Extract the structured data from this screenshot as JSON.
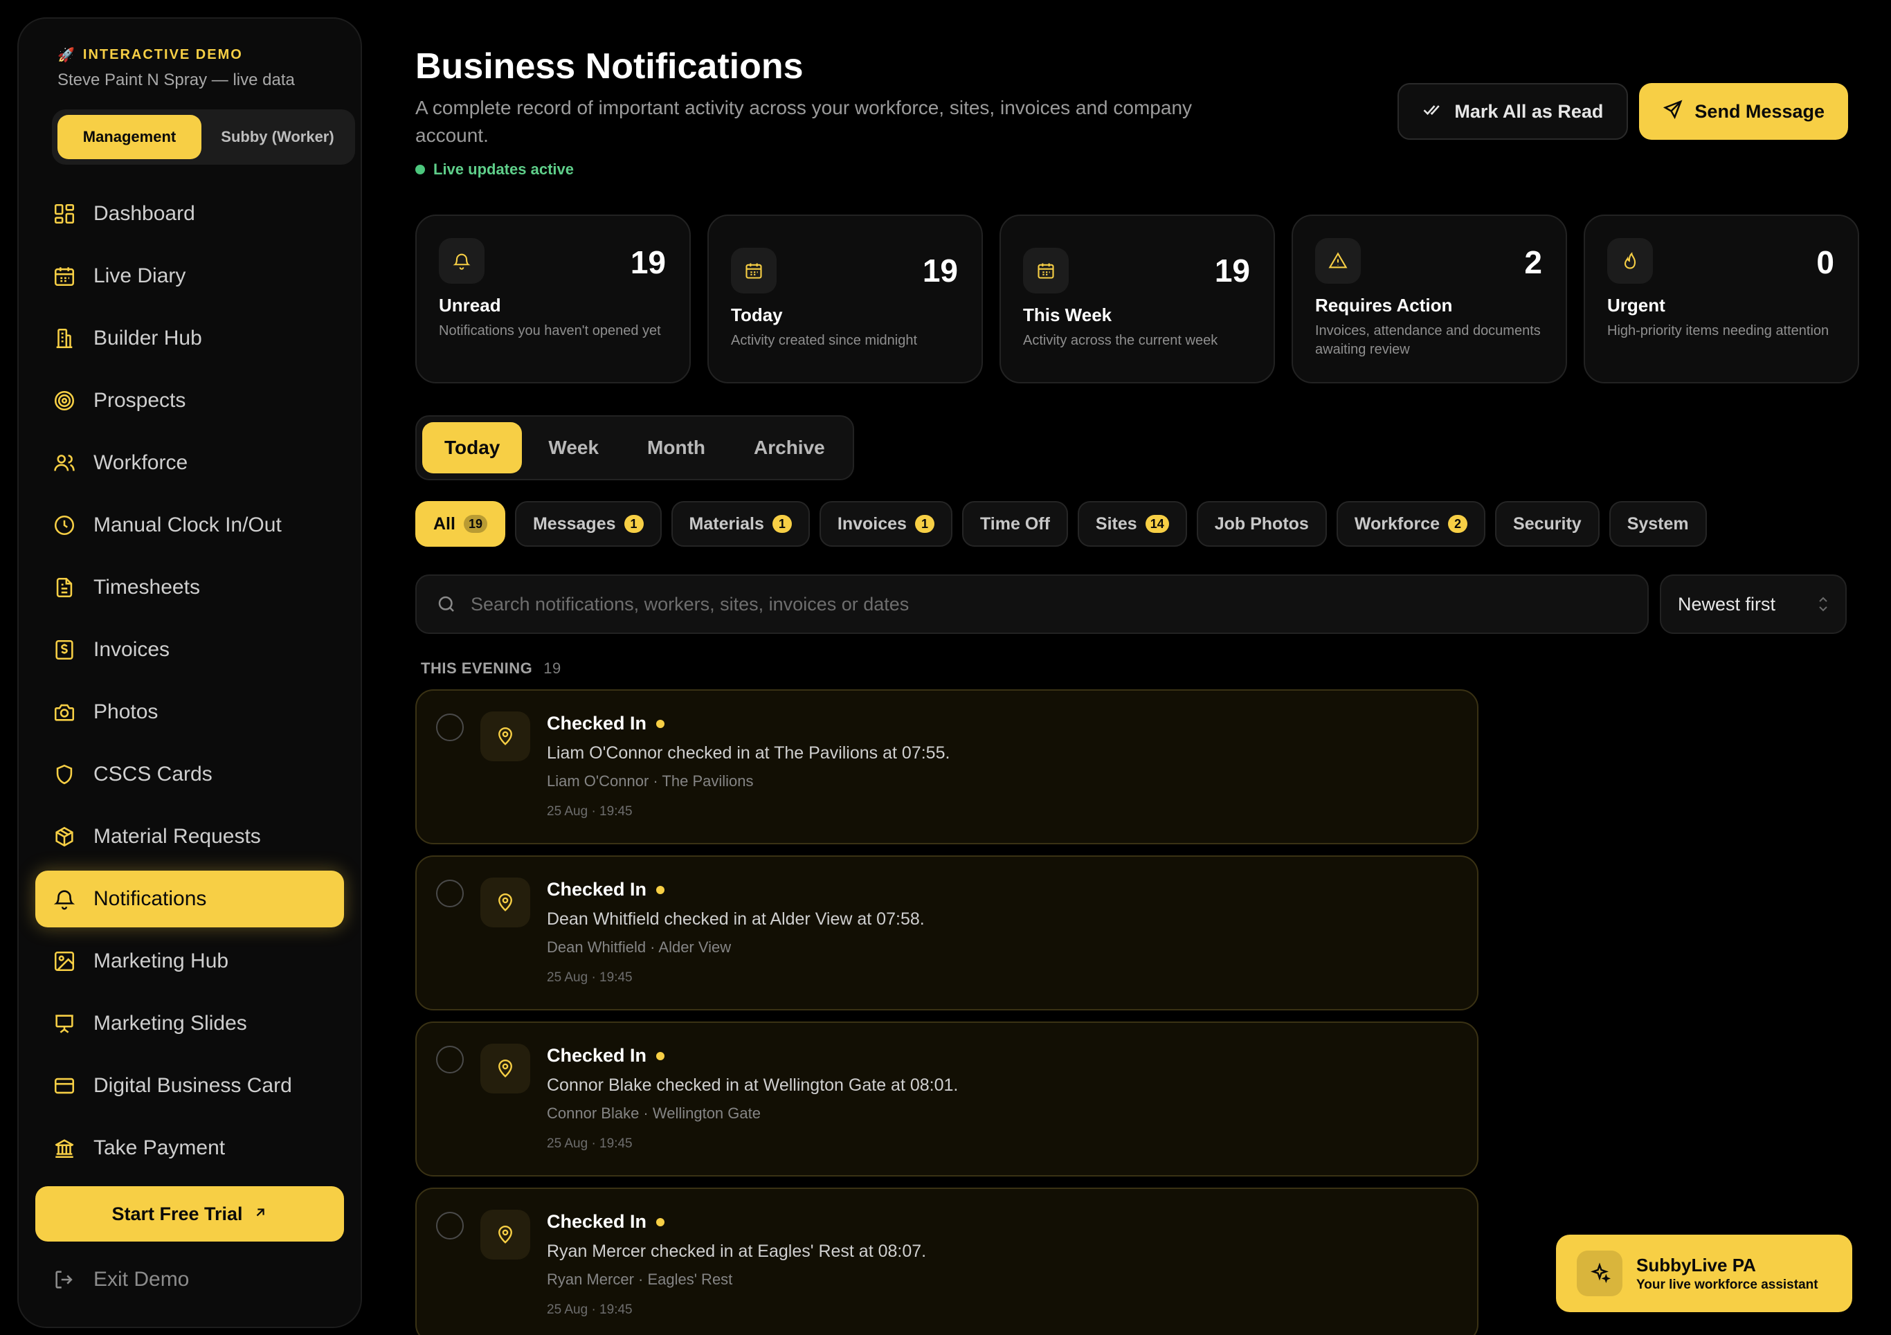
{
  "sidebar": {
    "demo_tag": "INTERACTIVE DEMO",
    "demo_emoji": "🚀",
    "account": "Steve Paint N Spray — live data",
    "roles": [
      {
        "label": "Management",
        "active": true
      },
      {
        "label": "Subby (Worker)",
        "active": false
      }
    ],
    "items": [
      {
        "label": "Dashboard",
        "icon": "dashboard-icon"
      },
      {
        "label": "Live Diary",
        "icon": "calendar-icon"
      },
      {
        "label": "Builder Hub",
        "icon": "building-icon"
      },
      {
        "label": "Prospects",
        "icon": "target-icon"
      },
      {
        "label": "Workforce",
        "icon": "users-icon"
      },
      {
        "label": "Manual Clock In/Out",
        "icon": "clock-icon"
      },
      {
        "label": "Timesheets",
        "icon": "document-icon"
      },
      {
        "label": "Invoices",
        "icon": "invoice-icon"
      },
      {
        "label": "Photos",
        "icon": "camera-icon"
      },
      {
        "label": "CSCS Cards",
        "icon": "shield-icon"
      },
      {
        "label": "Material Requests",
        "icon": "box-icon"
      },
      {
        "label": "Notifications",
        "icon": "bell-icon",
        "active": true
      },
      {
        "label": "Marketing Hub",
        "icon": "image-icon"
      },
      {
        "label": "Marketing Slides",
        "icon": "presentation-icon"
      },
      {
        "label": "Digital Business Card",
        "icon": "card-icon"
      },
      {
        "label": "Take Payment",
        "icon": "bank-icon"
      }
    ],
    "trial_label": "Start Free Trial",
    "exit_label": "Exit Demo"
  },
  "header": {
    "title": "Business Notifications",
    "description": "A complete record of important activity across your workforce, sites, invoices and company account.",
    "live_status": "Live updates active",
    "mark_all_label": "Mark All as Read",
    "send_message_label": "Send Message"
  },
  "stats": [
    {
      "icon": "bell-icon",
      "value": "19",
      "label": "Unread",
      "desc": "Notifications you haven't opened yet"
    },
    {
      "icon": "calendar-icon",
      "value": "19",
      "label": "Today",
      "desc": "Activity created since midnight"
    },
    {
      "icon": "calendar-icon",
      "value": "19",
      "label": "This Week",
      "desc": "Activity across the current week"
    },
    {
      "icon": "warning-icon",
      "value": "2",
      "label": "Requires Action",
      "desc": "Invoices, attendance and documents awaiting review"
    },
    {
      "icon": "flame-icon",
      "value": "0",
      "label": "Urgent",
      "desc": "High-priority items needing attention"
    }
  ],
  "tabs": [
    {
      "label": "Today",
      "active": true
    },
    {
      "label": "Week"
    },
    {
      "label": "Month"
    },
    {
      "label": "Archive"
    }
  ],
  "filters": [
    {
      "label": "All",
      "count": "19",
      "active": true
    },
    {
      "label": "Messages",
      "count": "1"
    },
    {
      "label": "Materials",
      "count": "1"
    },
    {
      "label": "Invoices",
      "count": "1"
    },
    {
      "label": "Time Off",
      "count": ""
    },
    {
      "label": "Sites",
      "count": "14"
    },
    {
      "label": "Job Photos",
      "count": ""
    },
    {
      "label": "Workforce",
      "count": "2"
    },
    {
      "label": "Security",
      "count": ""
    },
    {
      "label": "System",
      "count": ""
    }
  ],
  "search": {
    "placeholder": "Search notifications, workers, sites, invoices or dates"
  },
  "sort": {
    "selected": "Newest first"
  },
  "group": {
    "label": "THIS EVENING",
    "count": "19"
  },
  "notifications": [
    {
      "title": "Checked In",
      "body": "Liam O'Connor checked in at The Pavilions at 07:55.",
      "meta": "Liam O'Connor · The Pavilions",
      "time": "25 Aug · 19:45"
    },
    {
      "title": "Checked In",
      "body": "Dean Whitfield checked in at Alder View at 07:58.",
      "meta": "Dean Whitfield · Alder View",
      "time": "25 Aug · 19:45"
    },
    {
      "title": "Checked In",
      "body": "Connor Blake checked in at Wellington Gate at 08:01.",
      "meta": "Connor Blake · Wellington Gate",
      "time": "25 Aug · 19:45"
    },
    {
      "title": "Checked In",
      "body": "Ryan Mercer checked in at Eagles' Rest at 08:07.",
      "meta": "Ryan Mercer · Eagles' Rest",
      "time": "25 Aug · 19:45"
    }
  ],
  "assistant": {
    "title": "SubbyLive PA",
    "subtitle": "Your live workforce assistant"
  },
  "colors": {
    "accent": "#f7cf45",
    "live": "#4cc77d",
    "background": "#000000"
  }
}
